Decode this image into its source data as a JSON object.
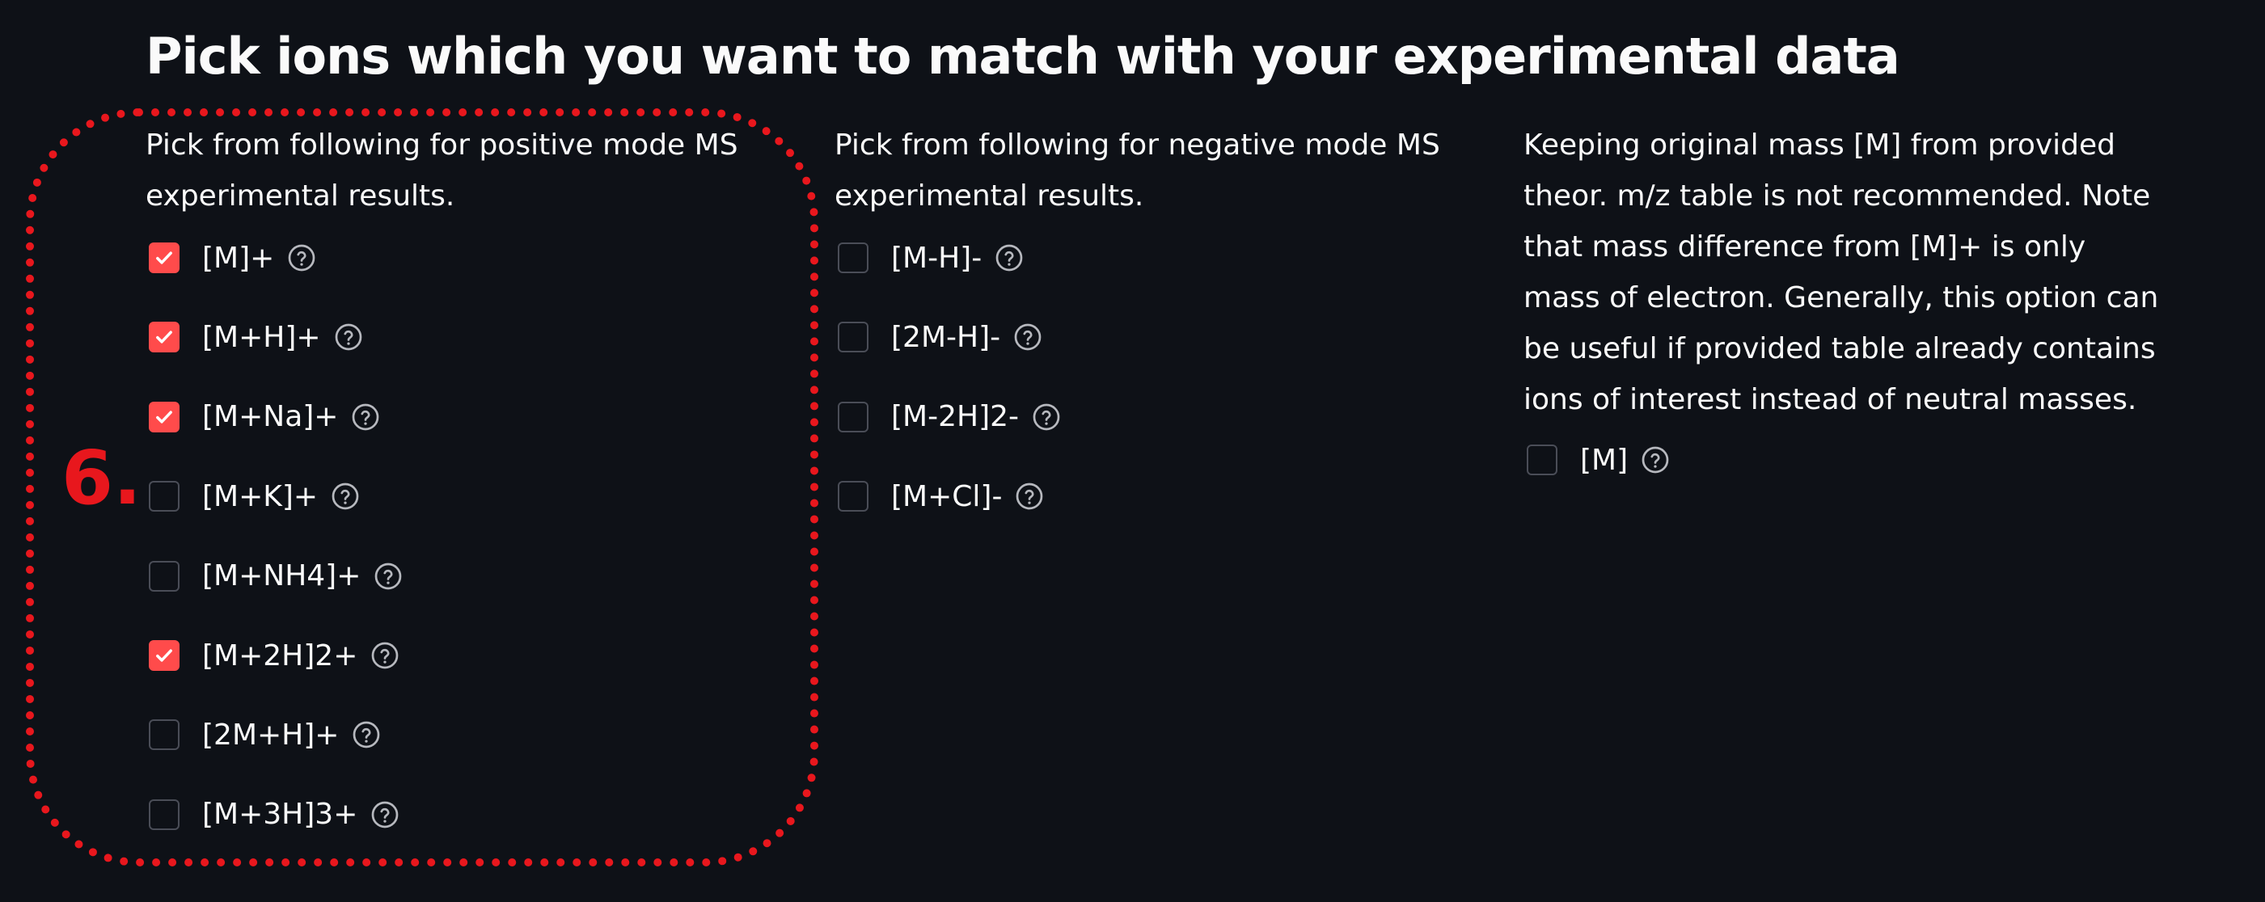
{
  "page": {
    "title": "Pick ions which you want to match with your experimental data"
  },
  "positive": {
    "description": "Pick from following for positive mode MS experimental results.",
    "options": [
      {
        "label": "[M]+",
        "checked": true
      },
      {
        "label": "[M+H]+",
        "checked": true
      },
      {
        "label": "[M+Na]+",
        "checked": true
      },
      {
        "label": "[M+K]+",
        "checked": false
      },
      {
        "label": "[M+NH4]+",
        "checked": false
      },
      {
        "label": "[M+2H]2+",
        "checked": true
      },
      {
        "label": "[2M+H]+",
        "checked": false
      },
      {
        "label": "[M+3H]3+",
        "checked": false
      }
    ]
  },
  "negative": {
    "description": "Pick from following for negative mode MS experimental results.",
    "options": [
      {
        "label": "[M-H]-",
        "checked": false
      },
      {
        "label": "[2M-H]-",
        "checked": false
      },
      {
        "label": "[M-2H]2-",
        "checked": false
      },
      {
        "label": "[M+Cl]-",
        "checked": false
      }
    ]
  },
  "keep_mass": {
    "description": "Keeping original mass [M] from provided theor. m/z table is not recommended. Note that mass difference from [M]+ is only mass of electron. Generally, this option can be useful if provided table already contains ions of interest instead of neutral masses.",
    "options": [
      {
        "label": "[M]",
        "checked": false
      }
    ]
  },
  "annotation": {
    "label": "6."
  },
  "icons": {
    "checkbox_checked": "check-icon",
    "help": "help-circle-icon"
  },
  "colors": {
    "background": "#0e1117",
    "text": "#fafafa",
    "checkbox_checked": "#ff4b4b",
    "checkbox_border": "#4a4d57",
    "help_icon": "#b6b8be",
    "annotation": "#e8171d"
  }
}
